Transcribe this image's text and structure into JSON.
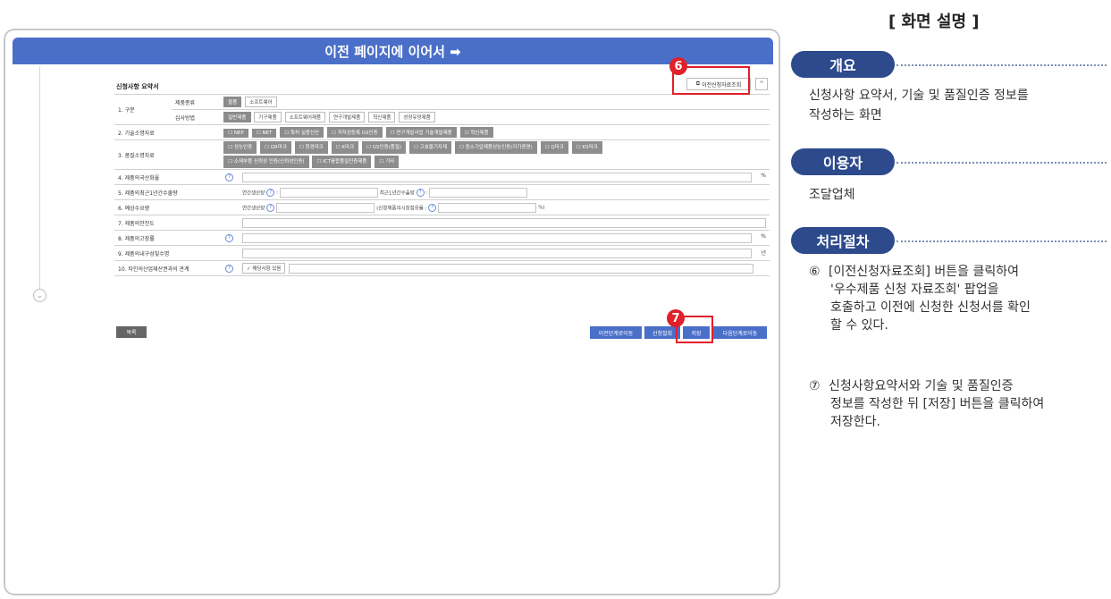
{
  "banner": {
    "title": "이전 페이지에 이어서 ➡"
  },
  "form": {
    "section_title": "신청사항 요약서",
    "prev_data_button": "이전신청자료조회",
    "collapse": "^",
    "rows": {
      "r1_label": "1. 구분",
      "r1_sub1": "제품종류",
      "r1_sub1_opts": [
        "물품",
        "소프트웨어"
      ],
      "r1_sub2": "심사방법",
      "r1_sub2_opts": [
        "일반제품",
        "기구제품",
        "소프트웨어제품",
        "연구개발제품",
        "혁신제품",
        "성장유망제품"
      ],
      "r2_label": "2. 기술소명자료",
      "r2_opts": [
        "☐ NEP",
        "☐ NET",
        "☐ 특허 실용신안",
        "☐ 저작권등록 GS인증",
        "☐ 연구개발사업 기술개발제품",
        "☐ 혁신제품"
      ],
      "r3_label": "3. 품질소명자료",
      "r3_opts": [
        "☐ 성능인증",
        "☐ GR마크",
        "☐ 환경마크",
        "☐ K마크",
        "☐ GS인증(품질)",
        "☐ 고효율기자재",
        "☐ 중소기업제품성능인증(자가증명)",
        "☐ Q마크",
        "☐ KS마크",
        "☐ 소재부품 신뢰성 인증(신뢰성인증)",
        "☐ ICT융합품질인증제품",
        "☐ 기타"
      ],
      "r4_label": "4. 제품의국산화율",
      "r4_unit": "%",
      "r5_label": "5. 제품의최근1년간수출량",
      "r5_a": "연간생산량",
      "r5_b": "최근1년간수출량",
      "r6_label": "6. 예상수요량",
      "r6_a": "연간생산량",
      "r6_b": "(신청제품의시장점유율 :",
      "r6_unit": "%)",
      "r7_label": "7. 제품의안전도",
      "r8_label": "8. 제품의고장률",
      "r8_unit": "%",
      "r9_label": "9. 제품의내구성및수명",
      "r9_unit": "년",
      "r10_label": "10. 타인의산업재산권과의 관계",
      "r10_check": "✓ 해당사항 있음"
    },
    "list_button": "목록",
    "prev_step_button": "이전단계로이동",
    "apply_button": "신청철회",
    "save_button": "저장",
    "next_step_button": "다음단계로이동",
    "qm": "?",
    "colon": ":"
  },
  "markers": {
    "m6": "6",
    "m7": "7"
  },
  "panel": {
    "title": "[ 화면 설명 ]",
    "overview_label": "개요",
    "overview_text_1": "신청사항 요약서, 기술 및 품질인증 정보를",
    "overview_text_2": "작성하는 화면",
    "user_label": "이용자",
    "user_text": "조달업체",
    "process_label": "처리절차",
    "step6_num": "⑥",
    "step6_l1": "[이전신청자료조회] 버튼을 클릭하여",
    "step6_l2": "'우수제품 신청 자료조회' 팝업을",
    "step6_l3": "호출하고 이전에 신청한 신청서를 확인",
    "step6_l4": "할 수 있다.",
    "step7_num": "⑦",
    "step7_l1": "신청사항요약서와 기술 및 품질인증",
    "step7_l2": "정보를 작성한 뒤 [저장] 버튼을 클릭하여",
    "step7_l3": "저장한다."
  },
  "colors": {
    "accent": "#4a6fc9",
    "pill": "#2d4a8c",
    "marker": "#e0202a"
  }
}
